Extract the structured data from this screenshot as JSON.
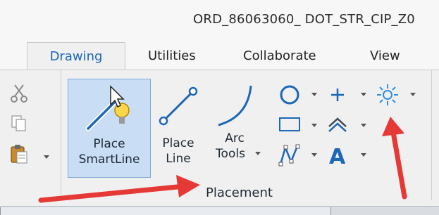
{
  "window": {
    "title": "ORD_86063060_ DOT_STR_CIP_Z0"
  },
  "tabs": [
    {
      "label": "Drawing"
    },
    {
      "label": "Utilities"
    },
    {
      "label": "Collaborate"
    },
    {
      "label": "View"
    }
  ],
  "ribbon": {
    "clipboard": {
      "icons": [
        "cut-icon",
        "copy-icon",
        "paste-icon"
      ]
    },
    "placement": {
      "group_label": "Placement",
      "place_smartline": {
        "line1": "Place",
        "line2": "SmartLine",
        "icon": "smartline-icon"
      },
      "place_line": {
        "line1": "Place",
        "line2": "Line",
        "icon": "line-icon"
      },
      "arc_tools": {
        "line1": "Arc",
        "line2": "Tools",
        "icon": "arc-icon"
      },
      "small_tools": [
        "circle-icon",
        "point-icon",
        "snap-icon",
        "rectangle-icon",
        "multiline-icon",
        "bspline-icon",
        "text-icon"
      ],
      "text_icon_glyph": "A"
    }
  },
  "colors": {
    "accent": "#1c67b8",
    "selection": "#c9def5",
    "annotation": "#e53935"
  }
}
